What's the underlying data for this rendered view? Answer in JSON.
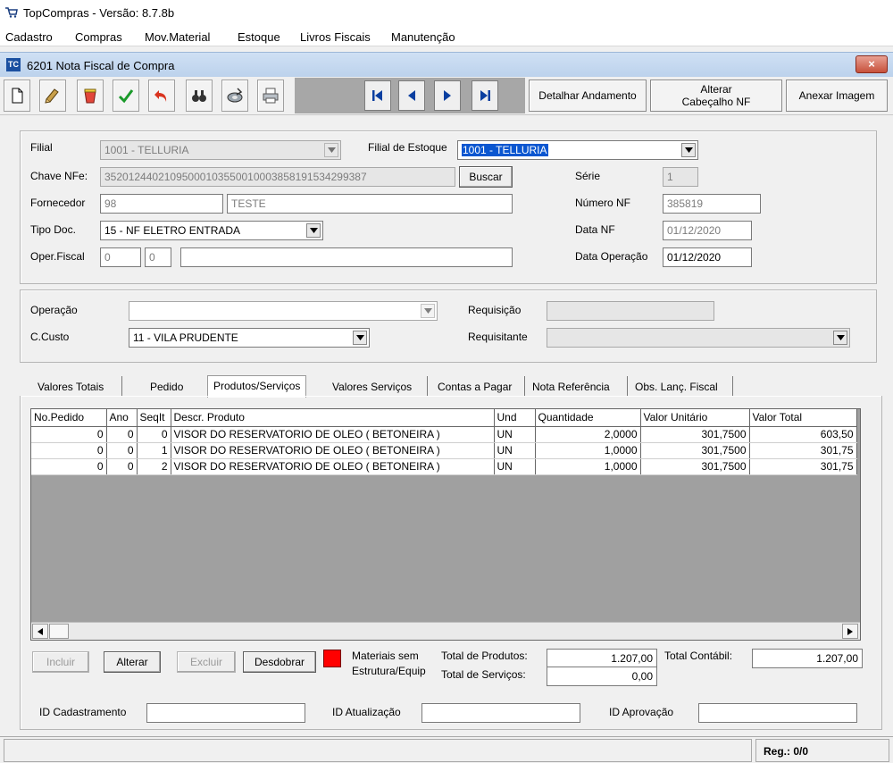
{
  "app": {
    "title": "TopCompras - Versão: 8.7.8b"
  },
  "menu": [
    "Cadastro",
    "Compras",
    "Mov.Material",
    "Estoque",
    "Livros Fiscais",
    "Manutenção"
  ],
  "window": {
    "title": "6201 Nota Fiscal de Compra",
    "close": "×"
  },
  "toolbar": {
    "icons": [
      "new-document-icon",
      "edit-icon",
      "clear-icon",
      "confirm-icon",
      "undo-icon",
      "search-binoculars-icon",
      "export-disk-icon",
      "print-icon"
    ],
    "nav": [
      "first-record-icon",
      "previous-record-icon",
      "next-record-icon",
      "last-record-icon"
    ],
    "detalhar": "Detalhar Andamento",
    "alterar_l1": "Alterar",
    "alterar_l2": "Cabeçalho NF",
    "anexar": "Anexar Imagem"
  },
  "header": {
    "filial_label": "Filial",
    "filial_value": "1001 - TELLURIA",
    "filial_estoque_label": "Filial de Estoque",
    "filial_estoque_value": "1001 - TELLURIA",
    "chave_label": "Chave NFe:",
    "chave_value": "35201244021095000103550010003858191534299387",
    "buscar": "Buscar",
    "serie_label": "Série",
    "serie_value": "1",
    "fornecedor_label": "Fornecedor",
    "fornecedor_code": "98",
    "fornecedor_name": "TESTE",
    "numero_label": "Número NF",
    "numero_value": "385819",
    "tipo_label": "Tipo Doc.",
    "tipo_value": "15 - NF ELETRO ENTRADA",
    "data_nf_label": "Data NF",
    "data_nf_value": "01/12/2020",
    "oper_label": "Oper.Fiscal",
    "oper_a": "0",
    "oper_b": "0",
    "oper_desc": "",
    "data_op_label": "Data Operação",
    "data_op_value": "01/12/2020"
  },
  "section2": {
    "operacao_label": "Operação",
    "operacao_value": "",
    "ccusto_label": "C.Custo",
    "ccusto_value": "11 - VILA PRUDENTE",
    "requisicao_label": "Requisição",
    "requisitante_label": "Requisitante"
  },
  "tabs": [
    "Valores Totais",
    "Pedido",
    "Produtos/Serviços",
    "Valores Serviços",
    "Contas a Pagar",
    "Nota Referência",
    "Obs. Lanç. Fiscal"
  ],
  "grid": {
    "columns": [
      "No.Pedido",
      "Ano",
      "SeqIt",
      "Descr. Produto",
      "Und",
      "Quantidade",
      "Valor Unitário",
      "Valor Total"
    ],
    "rows": [
      [
        "0",
        "0",
        "0",
        "VISOR DO RESERVATORIO DE OLEO ( BETONEIRA )",
        "UN",
        "2,0000",
        "301,7500",
        "603,50"
      ],
      [
        "0",
        "0",
        "1",
        "VISOR DO RESERVATORIO DE OLEO ( BETONEIRA )",
        "UN",
        "1,0000",
        "301,7500",
        "301,75"
      ],
      [
        "0",
        "0",
        "2",
        "VISOR DO RESERVATORIO DE OLEO ( BETONEIRA )",
        "UN",
        "1,0000",
        "301,7500",
        "301,75"
      ]
    ]
  },
  "actions": {
    "incluir": "Incluir",
    "alterar": "Alterar",
    "excluir": "Excluir",
    "desdobrar": "Desdobrar"
  },
  "legend": {
    "color": "#ff0000",
    "line1": "Materiais sem",
    "line2": "Estrutura/Equip"
  },
  "totals": {
    "produtos_label": "Total de Produtos:",
    "produtos_value": "1.207,00",
    "servicos_label": "Total de Serviços:",
    "servicos_value": "0,00",
    "contabil_label": "Total Contábil:",
    "contabil_value": "1.207,00"
  },
  "ids": {
    "cadastro_label": "ID Cadastramento",
    "atualizacao_label": "ID Atualização",
    "aprovacao_label": "ID Aprovação"
  },
  "status": {
    "reg": "Reg.: 0/0"
  }
}
